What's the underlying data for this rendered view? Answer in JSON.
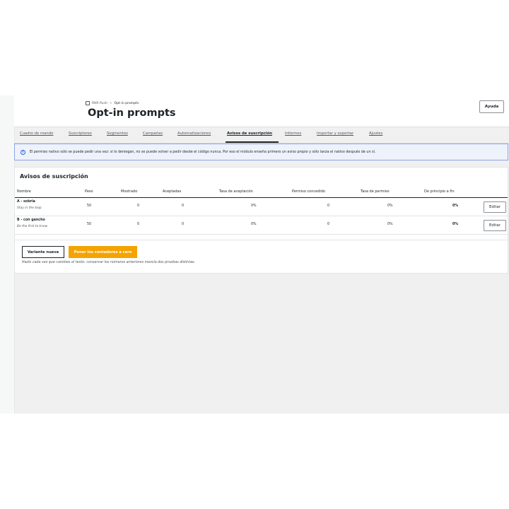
{
  "header": {
    "breadcrumb": {
      "home": "RKR Push",
      "separator": ">",
      "current": "Opt-in prompts"
    },
    "title": "Opt-in prompts",
    "help_label": "Ayuda"
  },
  "tabs": [
    {
      "label": "Cuadro de mando"
    },
    {
      "label": "Suscriptores"
    },
    {
      "label": "Segmentos"
    },
    {
      "label": "Campañas"
    },
    {
      "label": "Automatizaciones"
    },
    {
      "label": "Avisos de suscripción",
      "active": true
    },
    {
      "label": "Informes"
    },
    {
      "label": "Importar y exportar"
    },
    {
      "label": "Ajustes"
    }
  ],
  "notice": {
    "icon": "info-icon",
    "text": "El permiso nativo sólo se puede pedir una vez: si lo deniegan, no se puede volver a pedir desde el código nunca. Por eso el módulo enseña primero un aviso propio y sólo lanza el nativo después de un sí."
  },
  "prompts": {
    "title": "Avisos de suscripción",
    "columns": [
      "Nombre",
      "Peso",
      "Mostrado",
      "Aceptadas",
      "Tasa de aceptación",
      "Permiso concedido",
      "Tasa de permiso",
      "De principio a fin"
    ],
    "rows": [
      {
        "name": "A - sobria",
        "subtitle": "Stay in the loop",
        "weight": "50",
        "shown": "0",
        "accepted": "0",
        "accept_rate": "0%",
        "granted": "0",
        "grant_rate": "0%",
        "end_to_end": "0%",
        "edit_label": "Editar"
      },
      {
        "name": "B - con gancho",
        "subtitle": "Be the first to know",
        "weight": "50",
        "shown": "0",
        "accepted": "0",
        "accept_rate": "0%",
        "granted": "0",
        "grant_rate": "0%",
        "end_to_end": "0%",
        "edit_label": "Editar"
      }
    ],
    "new_variant_label": "Variante nueva",
    "reset_label": "Poner los contadores a cero",
    "hint": "Hazlo cada vez que cambies el texto: conservar los números anteriores mezcla dos pruebas distintas."
  },
  "colors": {
    "accent": "#f5a300",
    "notice_border": "#8ea3e6",
    "notice_bg": "#eef2fb"
  }
}
